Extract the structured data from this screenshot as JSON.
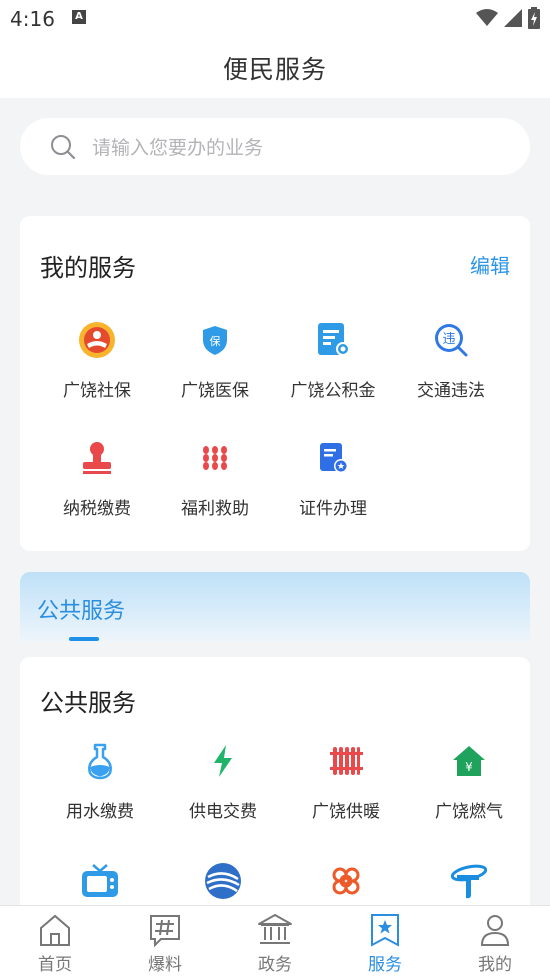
{
  "status_bar": {
    "time": "4:16",
    "indicator": "A"
  },
  "header": {
    "title": "便民服务"
  },
  "search": {
    "placeholder": "请输入您要办的业务"
  },
  "my_services": {
    "title": "我的服务",
    "edit_label": "编辑",
    "items": [
      {
        "label": "广饶社保",
        "icon": "social-security-icon"
      },
      {
        "label": "广饶医保",
        "icon": "medical-insurance-icon"
      },
      {
        "label": "广饶公积金",
        "icon": "housing-fund-icon"
      },
      {
        "label": "交通违法",
        "icon": "traffic-violation-icon"
      },
      {
        "label": "纳税缴费",
        "icon": "tax-stamp-icon"
      },
      {
        "label": "福利救助",
        "icon": "welfare-icon"
      },
      {
        "label": "证件办理",
        "icon": "certificate-icon"
      }
    ]
  },
  "public_tab": {
    "label": "公共服务"
  },
  "public_services": {
    "title": "公共服务",
    "items": [
      {
        "label": "用水缴费",
        "icon": "water-flask-icon"
      },
      {
        "label": "供电交费",
        "icon": "lightning-icon"
      },
      {
        "label": "广饶供暖",
        "icon": "radiator-icon"
      },
      {
        "label": "广饶燃气",
        "icon": "gas-house-icon"
      },
      {
        "label": "",
        "icon": "tv-icon"
      },
      {
        "label": "",
        "icon": "china-mobile-icon"
      },
      {
        "label": "",
        "icon": "china-unicom-icon"
      },
      {
        "label": "",
        "icon": "china-telecom-icon"
      }
    ]
  },
  "tabbar": {
    "active": "服务",
    "items": [
      {
        "label": "首页",
        "icon": "home-icon"
      },
      {
        "label": "爆料",
        "icon": "hashtag-icon"
      },
      {
        "label": "政务",
        "icon": "government-icon"
      },
      {
        "label": "服务",
        "icon": "service-star-icon"
      },
      {
        "label": "我的",
        "icon": "profile-icon"
      }
    ]
  },
  "colors": {
    "accent": "#2b8ee0",
    "edit_link": "#2b95e8",
    "placeholder": "#b4b4b8"
  }
}
